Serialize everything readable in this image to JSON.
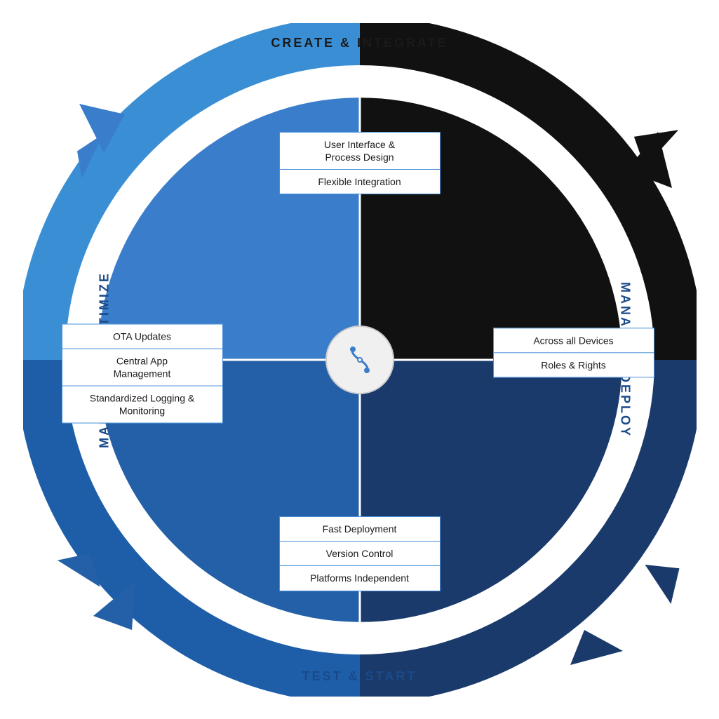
{
  "labels": {
    "top": "CREATE & INTEGRATE",
    "right": "MANAGE & DEPLOY",
    "bottom": "TEST & START",
    "left": "MAINTAIN & OPTIMIZE"
  },
  "boxes": {
    "top": {
      "items": [
        "User Interface &\nProcess Design",
        "Flexible Integration"
      ]
    },
    "right": {
      "items": [
        "Across all Devices",
        "Roles & Rights"
      ]
    },
    "bottom": {
      "items": [
        "Fast Deployment",
        "Version Control",
        "Platforms Independent"
      ]
    },
    "left": {
      "items": [
        "OTA Updates",
        "Central App\nManagement",
        "Standardized Logging &\nMonitoring"
      ]
    }
  },
  "colors": {
    "black_segment": "#111111",
    "dark_blue_segment": "#1a3a6b",
    "mid_blue_segment": "#1e5ea8",
    "light_blue_segment": "#3a8fd4",
    "arrow_blue": "#3a8fd4",
    "box_border": "#4a90d9"
  }
}
